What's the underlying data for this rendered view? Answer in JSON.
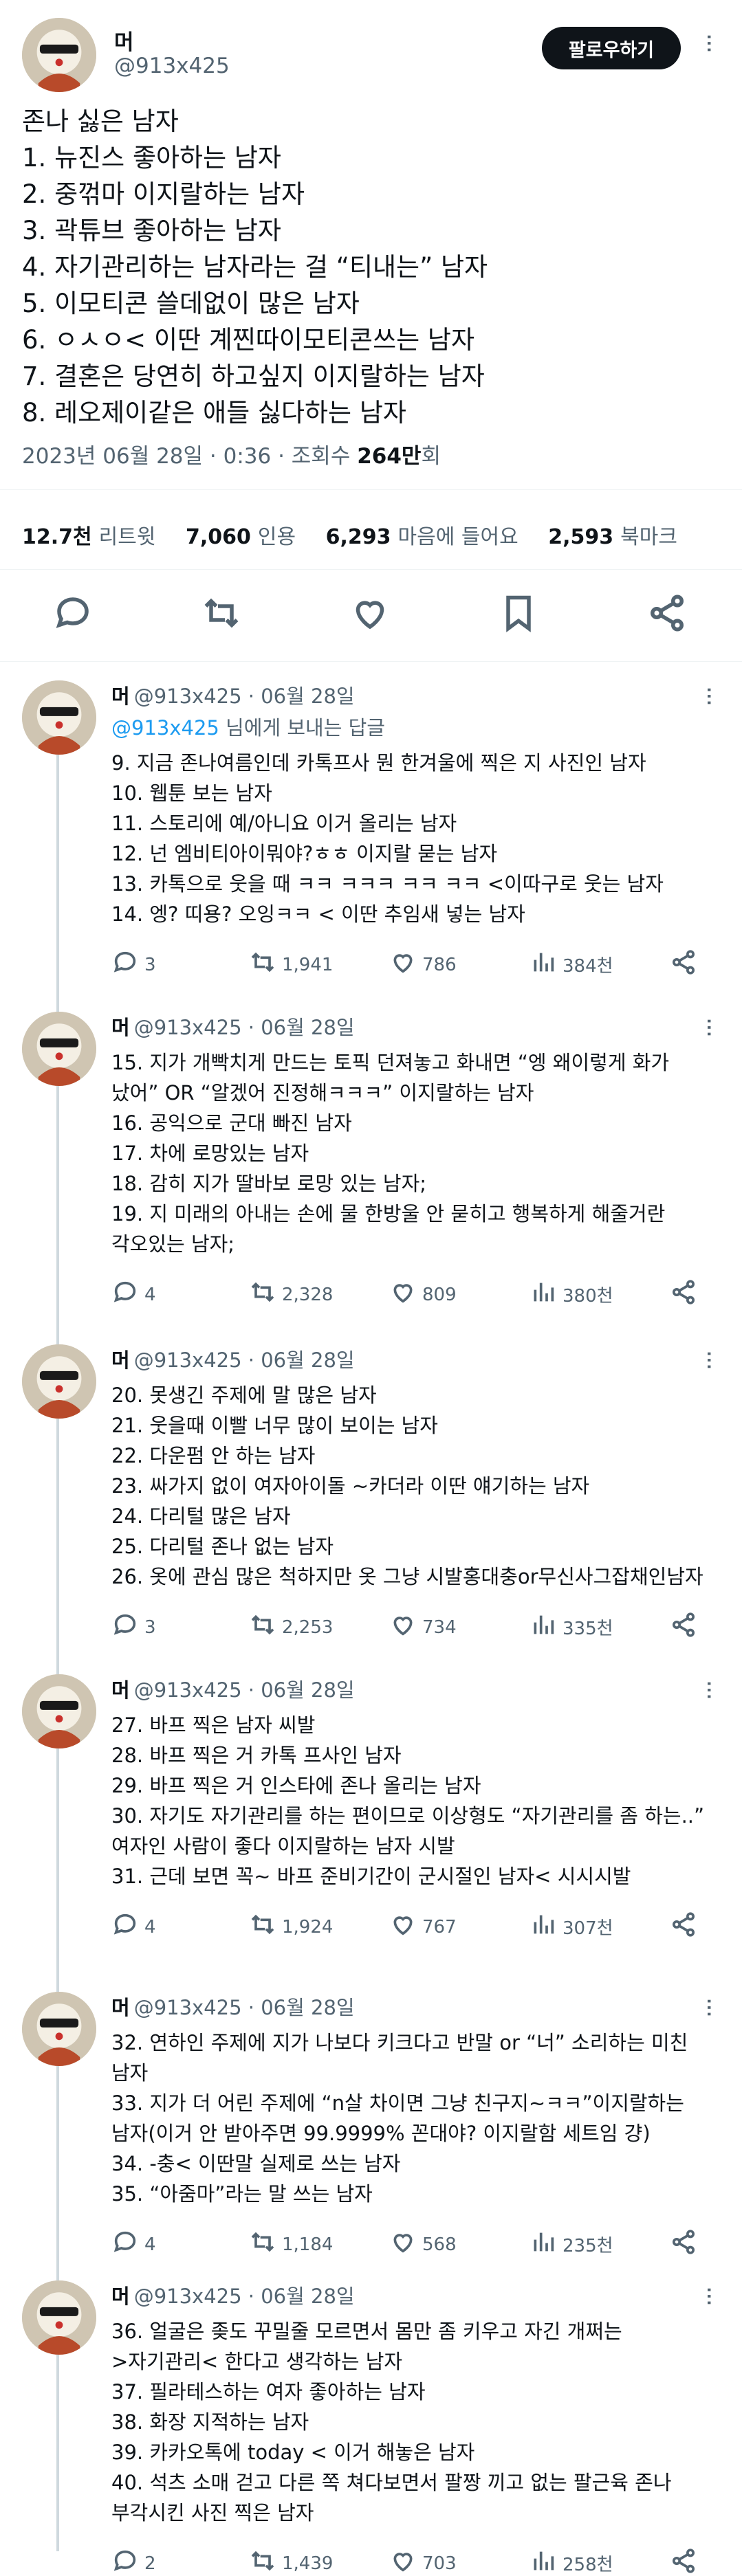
{
  "author": {
    "name": "머",
    "handle": "@913x425"
  },
  "follow_label": "팔로우하기",
  "more_label": "···",
  "tweet": {
    "lines": [
      "존나 싫은 남자",
      "1. 뉴진스 좋아하는 남자",
      "2. 중꺾마 이지랄하는 남자",
      "3. 곽튜브 좋아하는 남자",
      "4. 자기관리하는 남자라는 걸 “티내는” 남자",
      "5. 이모티콘 쓸데없이 많은 남자",
      "6. ㅇㅅㅇ< 이딴 계찐따이모티콘쓰는 남자",
      "7. 결혼은 당연히 하고싶지 이지랄하는 남자",
      "8. 레오제이같은 애들 싫다하는 남자"
    ],
    "date": "2023년 06월 28일 · 0:36 · 조회수 ",
    "views": "264만",
    "views_suffix": "회"
  },
  "stats": {
    "retweets_value": "12.7천",
    "retweets_label": "리트윗",
    "quotes_value": "7,060",
    "quotes_label": "인용",
    "likes_value": "6,293",
    "likes_label": "마음에 들어요",
    "bookmarks_value": "2,593",
    "bookmarks_label": "북마크"
  },
  "action_icons": [
    "reply-icon",
    "retweet-icon",
    "like-icon",
    "bookmark-icon",
    "share-icon"
  ],
  "replies": [
    {
      "name": "머",
      "meta": "@913x425 · 06월 28일",
      "replying_mention": "@913x425",
      "replying_suffix": " 님에게 보내는 답글",
      "lines": [
        "9. 지금 존나여름인데 카톡프사 뭔 한겨울에 찍은 지 사진인 남자",
        "10. 웹툰 보는 남자",
        "11. 스토리에 예/아니요 이거 올리는 남자",
        "12. 넌 엠비티아이뭐야?ㅎㅎ 이지랄 묻는 남자",
        "13. 카톡으로 웃을 때 ㅋㅋ ㅋㅋㅋ ㅋㅋ ㅋㅋ <이따구로 웃는 남자",
        "14. 엥? 띠용? 오잉ㅋㅋ < 이딴 추임새 넣는 남자"
      ],
      "replies": "3",
      "retweets": "1,941",
      "likes": "786",
      "views": "384천"
    },
    {
      "name": "머",
      "meta": "@913x425 · 06월 28일",
      "lines": [
        "15. 지가 개빡치게 만드는 토픽 던져놓고 화내면 “엥 왜이렇게 화가",
        "났어” OR “알겠어 진정해ㅋㅋㅋ” 이지랄하는 남자",
        "16. 공익으로 군대 빠진 남자",
        "17. 차에 로망있는 남자",
        "18. 감히 지가 딸바보 로망 있는 남자;",
        "19. 지 미래의 아내는 손에 물 한방울 안 묻히고 행복하게 해줄거란",
        "각오있는 남자;"
      ],
      "replies": "4",
      "retweets": "2,328",
      "likes": "809",
      "views": "380천"
    },
    {
      "name": "머",
      "meta": "@913x425 · 06월 28일",
      "lines": [
        "20. 못생긴 주제에 말 많은 남자",
        "21. 웃을때 이빨 너무 많이 보이는 남자",
        "22. 다운펌 안 하는 남자",
        "23. 싸가지 없이 여자아이돌 ~카더라 이딴 얘기하는 남자",
        "24. 다리털 많은 남자",
        "25. 다리털 존나 없는 남자",
        "26. 옷에 관심 많은 척하지만 옷 그냥 시발홍대충or무신사그잡채인남자"
      ],
      "replies": "3",
      "retweets": "2,253",
      "likes": "734",
      "views": "335천"
    },
    {
      "name": "머",
      "meta": "@913x425 · 06월 28일",
      "lines": [
        "27. 바프 찍은 남자 씨발",
        "28. 바프 찍은 거 카톡 프사인 남자",
        "29. 바프 찍은 거 인스타에 존나 올리는 남자",
        "30. 자기도 자기관리를 하는 편이므로 이상형도 “자기관리를 좀 하는..”",
        "여자인 사람이 좋다 이지랄하는 남자 시발",
        "31. 근데 보면 꼭~ 바프 준비기간이 군시절인 남자< 시시시발"
      ],
      "replies": "4",
      "retweets": "1,924",
      "likes": "767",
      "views": "307천"
    },
    {
      "name": "머",
      "meta": "@913x425 · 06월 28일",
      "lines": [
        "32. 연하인 주제에 지가 나보다 키크다고 반말 or “너” 소리하는 미친",
        "남자",
        "33. 지가 더 어린 주제에 “n살 차이면 그냥 친구지~ㅋㅋ”이지랄하는",
        "남자(이거 안 받아주면 99.9999% 꼰대야? 이지랄함 세트임 걍)",
        "34. -충< 이딴말 실제로 쓰는 남자",
        "35. “아줌마”라는 말 쓰는 남자"
      ],
      "replies": "4",
      "retweets": "1,184",
      "likes": "568",
      "views": "235천"
    },
    {
      "name": "머",
      "meta": "@913x425 · 06월 28일",
      "lines": [
        "36. 얼굴은 좆도 꾸밀줄 모르면서 몸만 좀 키우고 자긴 개쩌는",
        ">자기관리< 한다고 생각하는 남자",
        "37. 필라테스하는 여자 좋아하는 남자",
        "38. 화장 지적하는 남자",
        "39. 카카오톡에 today < 이거 해놓은 남자",
        "40. 석츠 소매 걷고 다른 쪽 쳐다보면서 팔짱 끼고 없는 팔근육 존나",
        "부각시킨 사진 찍은 남자"
      ],
      "replies": "2",
      "retweets": "1,439",
      "likes": "703",
      "views": "258천"
    }
  ]
}
